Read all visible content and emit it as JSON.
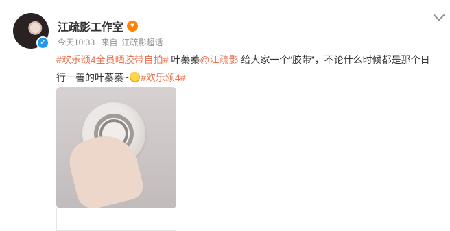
{
  "author": {
    "name": "江疏影工作室",
    "badge_icon": "heart-eyes-icon"
  },
  "meta": {
    "time": "今天10:33",
    "source_prefix": "来自",
    "source": "江疏影超话"
  },
  "post": {
    "tag1": "#欢乐颂4全员晒胶带自拍#",
    "text1": " 叶蓁蓁",
    "mention": "@江疏影",
    "text2": " 给大家一个“胶带”，不论什么时候都是那个日行一善的叶蓁蓁~",
    "tag2": "#欢乐颂4#"
  },
  "colors": {
    "accent": "#eb7350",
    "meta": "#939393"
  }
}
